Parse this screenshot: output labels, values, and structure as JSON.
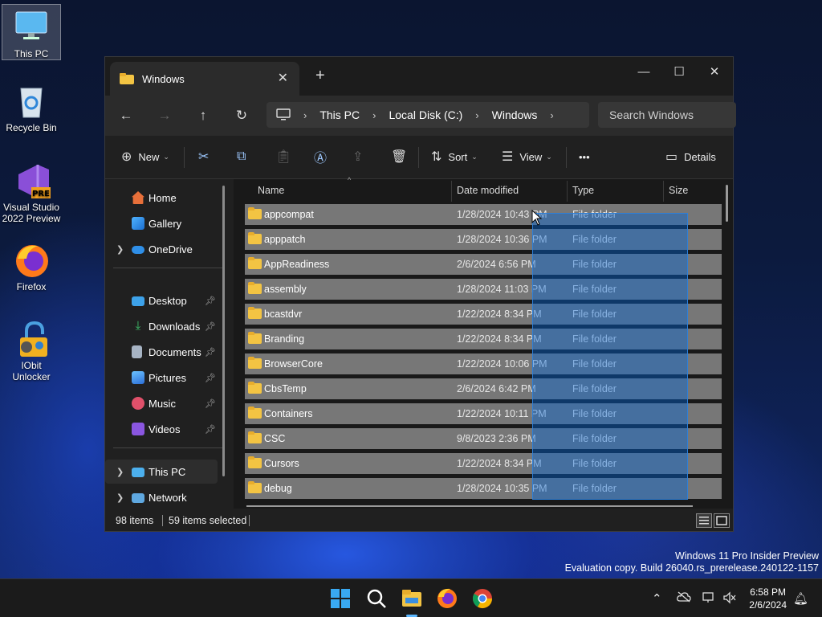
{
  "desktop": {
    "icons": [
      {
        "label": "This PC"
      },
      {
        "label": "Recycle Bin"
      },
      {
        "label": "Visual Studio 2022 Preview",
        "badge": "PRE"
      },
      {
        "label": "Firefox"
      },
      {
        "label": "IObit Unlocker"
      }
    ]
  },
  "window": {
    "tab_title": "Windows",
    "tab_close": "✕",
    "new_tab": "+",
    "controls": {
      "minimize": "—",
      "maximize": "☐",
      "close": "✕"
    }
  },
  "navigation": {
    "back": "←",
    "forward": "→",
    "up": "↑",
    "refresh": "↻",
    "breadcrumbs": [
      "This PC",
      "Local Disk (C:)",
      "Windows"
    ],
    "search_placeholder": "Search Windows"
  },
  "commands": {
    "new": "New",
    "sort": "Sort",
    "view": "View",
    "more": "•••",
    "details": "Details"
  },
  "sidebar": {
    "top": [
      {
        "label": "Home",
        "icon": "home-icon"
      },
      {
        "label": "Gallery",
        "icon": "gallery-icon"
      },
      {
        "label": "OneDrive",
        "icon": "cloud-icon"
      }
    ],
    "quick": [
      {
        "label": "Desktop",
        "icon": "desktop-icon"
      },
      {
        "label": "Downloads",
        "icon": "download-icon"
      },
      {
        "label": "Documents",
        "icon": "documents-icon"
      },
      {
        "label": "Pictures",
        "icon": "pictures-icon"
      },
      {
        "label": "Music",
        "icon": "music-icon"
      },
      {
        "label": "Videos",
        "icon": "videos-icon"
      }
    ],
    "bottom": [
      {
        "label": "This PC",
        "icon": "computer-icon"
      },
      {
        "label": "Network",
        "icon": "network-icon"
      }
    ]
  },
  "columns": {
    "name": "Name",
    "date": "Date modified",
    "type": "Type",
    "size": "Size"
  },
  "files": [
    {
      "name": "appcompat",
      "date": "1/28/2024 10:43 PM",
      "type": "File folder"
    },
    {
      "name": "apppatch",
      "date": "1/28/2024 10:36 PM",
      "type": "File folder"
    },
    {
      "name": "AppReadiness",
      "date": "2/6/2024 6:56 PM",
      "type": "File folder"
    },
    {
      "name": "assembly",
      "date": "1/28/2024 11:03 PM",
      "type": "File folder"
    },
    {
      "name": "bcastdvr",
      "date": "1/22/2024 8:34 PM",
      "type": "File folder"
    },
    {
      "name": "Branding",
      "date": "1/22/2024 8:34 PM",
      "type": "File folder"
    },
    {
      "name": "BrowserCore",
      "date": "1/22/2024 10:06 PM",
      "type": "File folder"
    },
    {
      "name": "CbsTemp",
      "date": "2/6/2024 6:42 PM",
      "type": "File folder"
    },
    {
      "name": "Containers",
      "date": "1/22/2024 10:11 PM",
      "type": "File folder"
    },
    {
      "name": "CSC",
      "date": "9/8/2023 2:36 PM",
      "type": "File folder"
    },
    {
      "name": "Cursors",
      "date": "1/22/2024 8:34 PM",
      "type": "File folder"
    },
    {
      "name": "debug",
      "date": "1/28/2024 10:35 PM",
      "type": "File folder"
    }
  ],
  "status": {
    "items": "98 items",
    "selected": "59 items selected"
  },
  "watermark": {
    "line1": "Windows 11 Pro Insider Preview",
    "line2": "Evaluation copy. Build 26040.rs_prerelease.240122-1157"
  },
  "taskbar": {
    "time": "6:58 PM",
    "date": "2/6/2024"
  }
}
